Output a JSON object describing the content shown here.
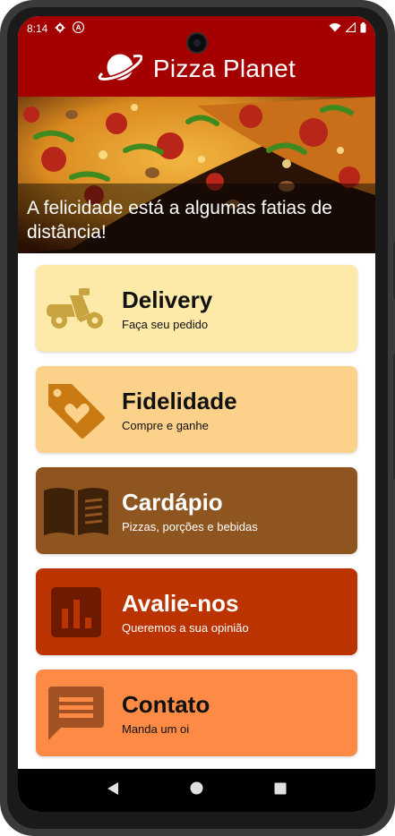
{
  "status_bar": {
    "time": "8:14"
  },
  "app": {
    "title": "Pizza Planet"
  },
  "hero": {
    "caption": "A felicidade está a algumas fatias de distância!"
  },
  "cards": [
    {
      "title": "Delivery",
      "subtitle": "Faça seu pedido",
      "icon": "scooter-icon",
      "bg": "#fde9a8",
      "icon_color": "#c8a440"
    },
    {
      "title": "Fidelidade",
      "subtitle": "Compre e ganhe",
      "icon": "price-tag-heart-icon",
      "bg": "#fcd18a",
      "icon_color": "#c97a12"
    },
    {
      "title": "Cardápio",
      "subtitle": "Pizzas, porções e bebidas",
      "icon": "open-book-icon",
      "bg": "#8f5520",
      "icon_color": "#3d2108"
    },
    {
      "title": "Avalie-nos",
      "subtitle": "Queremos a sua opinião",
      "icon": "bar-chart-icon",
      "bg": "#bb3400",
      "icon_color": "#6e1a00"
    },
    {
      "title": "Contato",
      "subtitle": "Manda um oi",
      "icon": "message-icon",
      "bg": "#fd8b45",
      "icon_color": "#a25224"
    }
  ],
  "colors": {
    "primary": "#a50000",
    "nav_bar": "#000000"
  }
}
